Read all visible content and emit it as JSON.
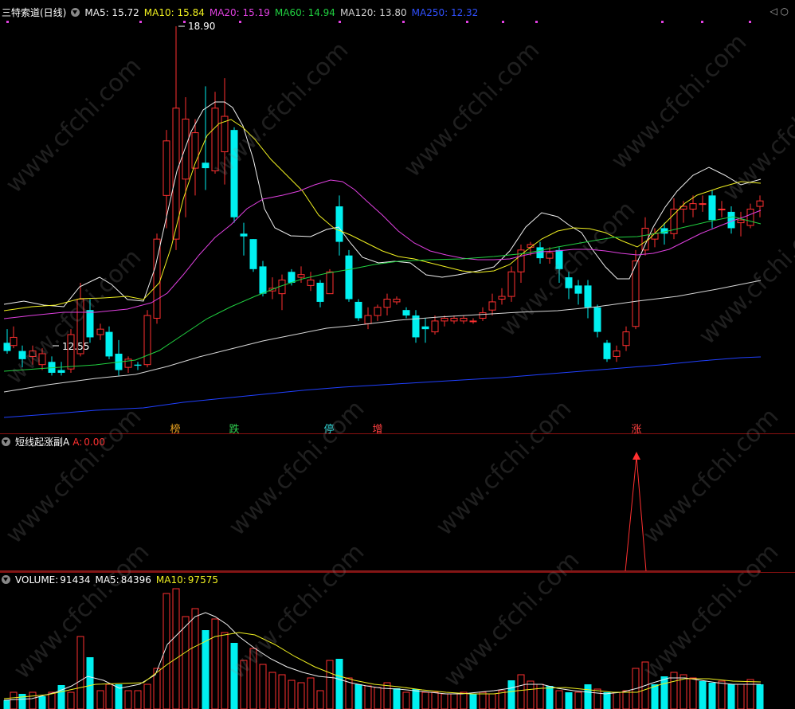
{
  "main": {
    "title": "三特索道(日线)",
    "ma": [
      {
        "label": "MA5",
        "value": "15.72",
        "color": "#f0f0f0"
      },
      {
        "label": "MA10",
        "value": "15.84",
        "color": "#f0f020"
      },
      {
        "label": "MA20",
        "value": "15.19",
        "color": "#e040e0"
      },
      {
        "label": "MA60",
        "value": "14.94",
        "color": "#20d040"
      },
      {
        "label": "MA120",
        "value": "13.80",
        "color": "#d0d0d0"
      },
      {
        "label": "MA250",
        "value": "12.32",
        "color": "#3050ff"
      }
    ],
    "high_label": "18.90",
    "low_label": "12.55",
    "markers": [
      {
        "text": "榜",
        "color": "#e6a020"
      },
      {
        "text": "跌",
        "color": "#30d050"
      },
      {
        "text": "停",
        "color": "#30d0d0"
      },
      {
        "text": "增",
        "color": "#ff4040"
      },
      {
        "text": "涨",
        "color": "#ff4040"
      }
    ]
  },
  "indicator": {
    "title": "短线起涨副A",
    "label": "A:",
    "value": "0.00"
  },
  "volume": {
    "label": "VOLUME:",
    "value": "91434",
    "ma5_label": "MA5:",
    "ma5": "84396",
    "ma10_label": "MA10:",
    "ma10": "97575"
  },
  "watermark": "www.cfchi.com",
  "colors": {
    "up": "#ff3030",
    "down": "#00f0f0",
    "bg": "#000000",
    "grid": "#8a1010"
  }
}
